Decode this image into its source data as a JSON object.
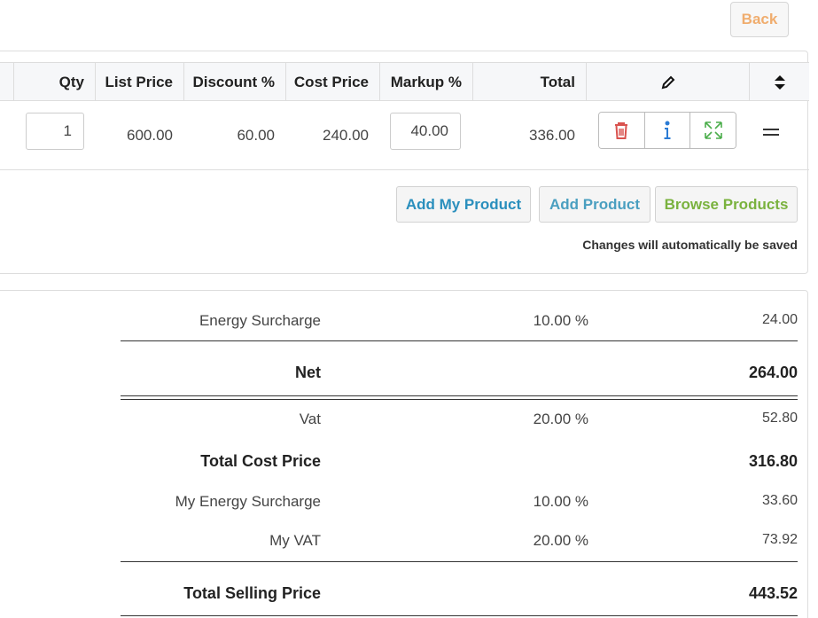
{
  "header": {
    "back_label": "Back"
  },
  "table": {
    "columns": [
      "Qty",
      "List Price",
      "Discount %",
      "Cost Price",
      "Markup %",
      "Total"
    ],
    "row": {
      "qty": "1",
      "list_price": "600.00",
      "discount": "60.00",
      "cost_price": "240.00",
      "markup": "40.00",
      "total": "336.00"
    }
  },
  "actions": {
    "add_my_product": "Add My Product",
    "add_product": "Add Product",
    "browse_products": "Browse Products",
    "autosave_note": "Changes will automatically be saved"
  },
  "totals": {
    "energy_surcharge": {
      "label": "Energy Surcharge",
      "pct": "10.00 %",
      "value": "24.00"
    },
    "net": {
      "label": "Net",
      "value": "264.00"
    },
    "vat": {
      "label": "Vat",
      "pct": "20.00 %",
      "value": "52.80"
    },
    "total_cost": {
      "label": "Total Cost Price",
      "value": "316.80"
    },
    "my_energy_surcharge": {
      "label": "My Energy Surcharge",
      "pct": "10.00 %",
      "value": "33.60"
    },
    "my_vat": {
      "label": "My VAT",
      "pct": "20.00 %",
      "value": "73.92"
    },
    "total_selling": {
      "label": "Total Selling Price",
      "value": "443.52"
    }
  },
  "colors": {
    "back": "#f0ad6e",
    "add_my_product": "#2a8fbd",
    "add_product": "#4a9fc0",
    "browse_products": "#7ab23e",
    "delete": "#d9534f",
    "info": "#2b7bd4",
    "expand": "#4cae4c"
  },
  "icons": [
    "pencil-icon",
    "sort-icon",
    "trash-icon",
    "info-icon",
    "expand-icon",
    "drag-handle-icon"
  ]
}
